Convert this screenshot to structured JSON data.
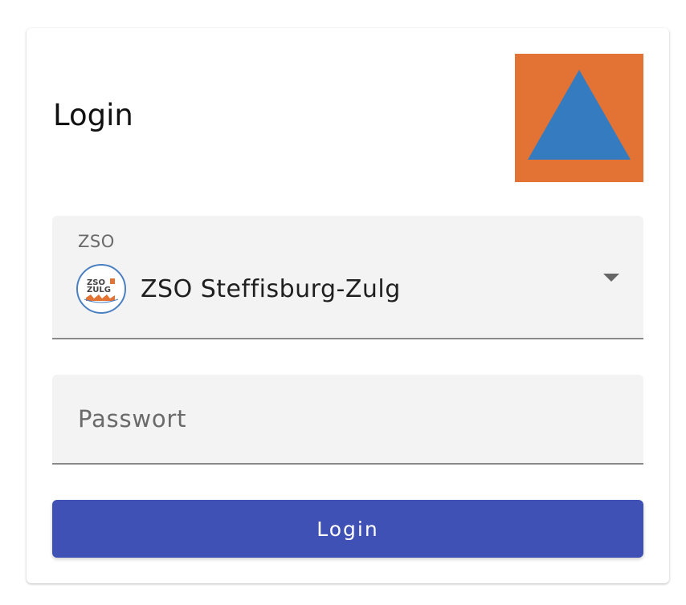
{
  "card": {
    "title": "Login"
  },
  "logo": {
    "icon": "civil-protection-triangle-icon",
    "background_color": "#e37335",
    "triangle_color": "#347bbf"
  },
  "org_select": {
    "label": "ZSO",
    "selected_value": "ZSO Steffisburg-Zulg",
    "avatar_icon": "zso-zulg-logo-icon",
    "avatar_text_top": "ZSO",
    "avatar_text_bottom": "ZULG"
  },
  "password": {
    "placeholder": "Passwort",
    "value": ""
  },
  "login_button": {
    "label": "Login",
    "color": "#3f51b5"
  }
}
